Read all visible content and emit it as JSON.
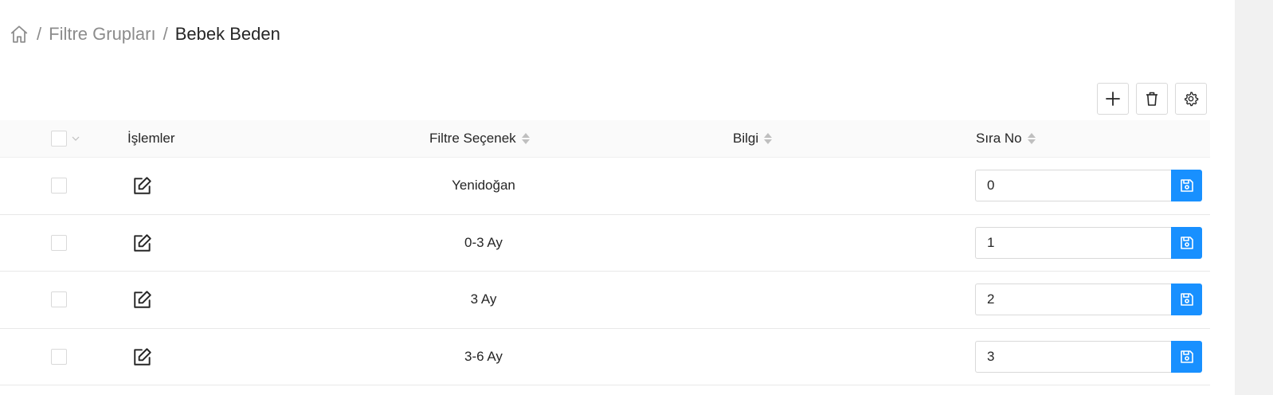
{
  "breadcrumb": {
    "home_icon": "home-icon",
    "separator": "/",
    "parent": "Filtre Grupları",
    "current": "Bebek Beden"
  },
  "toolbar": {
    "buttons": [
      {
        "name": "add-button",
        "icon": "plus-icon"
      },
      {
        "name": "delete-button",
        "icon": "trash-icon"
      },
      {
        "name": "settings-button",
        "icon": "gear-icon"
      }
    ]
  },
  "table": {
    "columns": {
      "actions": "İşlemler",
      "option": "Filtre Seçenek",
      "info": "Bilgi",
      "order": "Sıra No"
    },
    "rows": [
      {
        "option": "Yenidoğan",
        "info": "",
        "order": "0"
      },
      {
        "option": "0-3 Ay",
        "info": "",
        "order": "1"
      },
      {
        "option": "3 Ay",
        "info": "",
        "order": "2"
      },
      {
        "option": "3-6 Ay",
        "info": "",
        "order": "3"
      }
    ]
  },
  "colors": {
    "primary": "#1890ff",
    "border": "#d9d9d9",
    "header_bg": "#fafafa"
  }
}
